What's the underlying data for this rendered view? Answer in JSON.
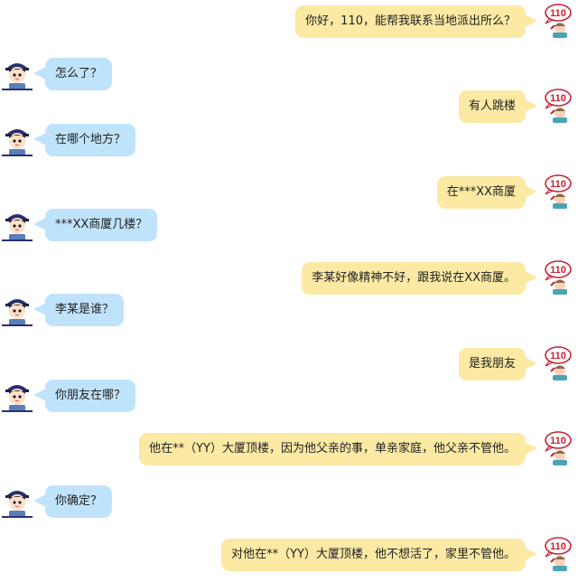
{
  "conversation": {
    "messages": [
      {
        "sender": "caller",
        "text": "你好，110，能帮我联系当地派出所么？"
      },
      {
        "sender": "police",
        "text": "怎么了？"
      },
      {
        "sender": "caller",
        "text": "有人跳楼"
      },
      {
        "sender": "police",
        "text": "在哪个地方？"
      },
      {
        "sender": "caller",
        "text": "在***XX商厦"
      },
      {
        "sender": "police",
        "text": "***XX商厦几楼？"
      },
      {
        "sender": "caller",
        "text": "李某好像精神不好，跟我说在XX商厦。"
      },
      {
        "sender": "police",
        "text": "李某是谁？"
      },
      {
        "sender": "caller",
        "text": "是我朋友"
      },
      {
        "sender": "police",
        "text": "你朋友在哪？"
      },
      {
        "sender": "caller",
        "text": "他在**（YY）大厦顶楼，因为他父亲的事，单亲家庭，他父亲不管他。"
      },
      {
        "sender": "police",
        "text": "你确定？"
      },
      {
        "sender": "caller",
        "text": "对他在**（YY）大厦顶楼，他不想活了，家里不管他。"
      }
    ]
  },
  "avatars": {
    "caller": {
      "badge_text": "110",
      "icon": "operator-110-icon"
    },
    "police": {
      "icon": "police-officer-icon"
    }
  },
  "colors": {
    "caller_bubble": "#fbe9a4",
    "police_bubble": "#bfe3fa",
    "text": "#222222",
    "background": "#ffffff"
  }
}
